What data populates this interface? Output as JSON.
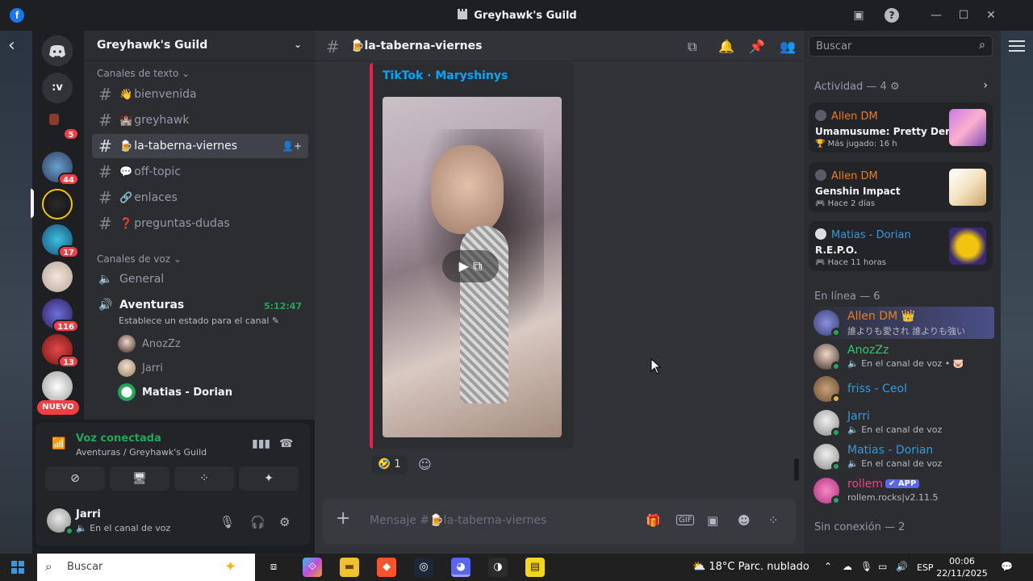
{
  "window": {
    "title": "Greyhawk's Guild"
  },
  "server_rail": {
    "dm_label": ":v",
    "badges": [
      "5",
      "44",
      "17",
      "116",
      "13"
    ],
    "new_label": "NUEVO"
  },
  "sidebar": {
    "guild_name": "Greyhawk's Guild",
    "text_category": "Canales de texto",
    "text_channels": [
      {
        "emoji": "👋",
        "name": "bienvenida"
      },
      {
        "emoji": "🏰",
        "name": "greyhawk"
      },
      {
        "emoji": "🍺",
        "name": "la-taberna-viernes"
      },
      {
        "emoji": "💬",
        "name": "off-topic"
      },
      {
        "emoji": "🔗",
        "name": "enlaces"
      },
      {
        "emoji": "❓",
        "name": "preguntas-dudas"
      }
    ],
    "voice_category": "Canales de voz",
    "voice_channels": [
      {
        "name": "General"
      },
      {
        "name": "Aventuras",
        "timer": "5:12:47",
        "status": "Establece un estado para el canal"
      }
    ],
    "voice_users": [
      "AnozZz",
      "Jarri",
      "Matias - Dorian"
    ]
  },
  "voice_panel": {
    "status": "Voz conectada",
    "location": "Aventuras / Greyhawk's Guild",
    "user_name": "Jarri",
    "user_status": "En el canal de voz"
  },
  "chat": {
    "channel_name": "la-taberna-viernes",
    "channel_emoji": "🍺",
    "embed_title": "TikTok · Maryshinys",
    "reaction_emoji": "🤣",
    "reaction_count": "1",
    "composer_placeholder": "Mensaje #🍺la-taberna-viernes"
  },
  "members": {
    "search_placeholder": "Buscar",
    "activity_header": "Actividad — 4",
    "activities": [
      {
        "user": "Allen DM",
        "game": "Umamusume: Pretty Derby",
        "time": "Más jugado: 16 h"
      },
      {
        "user": "Allen DM",
        "game": "Genshin Impact",
        "time": "Hace 2 días"
      },
      {
        "user": "Matias - Dorian",
        "game": "R.E.P.O.",
        "time": "Hace 11 horas"
      }
    ],
    "online_header": "En línea — 6",
    "online": [
      {
        "name": "Allen DM 👑",
        "status": "誰よりも愛され 誰よりも強い",
        "color": "#e67e22"
      },
      {
        "name": "AnozZz",
        "status": "En el canal de voz • 🐷",
        "color": "#2ecc71"
      },
      {
        "name": "friss - Ceol",
        "status": "",
        "color": "#3498db"
      },
      {
        "name": "Jarri",
        "status": "En el canal de voz",
        "color": "#3498db"
      },
      {
        "name": "Matias - Dorian",
        "status": "En el canal de voz",
        "color": "#3498db"
      },
      {
        "name": "rollem",
        "badge": "✔ APP",
        "status": "rollem.rocks|v2.11.5",
        "color": "#f23f8a"
      }
    ],
    "offline_header": "Sin conexión — 2"
  },
  "taskbar": {
    "search_placeholder": "Buscar",
    "weather": "18°C  Parc. nublado",
    "lang": "ESP",
    "time": "00:06",
    "date": "22/11/2025"
  }
}
